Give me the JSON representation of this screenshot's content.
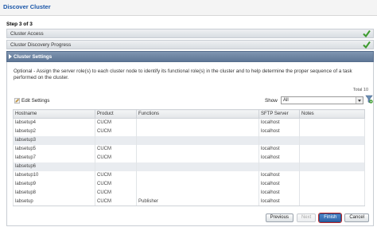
{
  "header": {
    "title": "Discover Cluster"
  },
  "step": {
    "label": "Step 3 of 3"
  },
  "accordion": [
    {
      "label": "Cluster Access",
      "done": true
    },
    {
      "label": "Cluster Discovery Progress",
      "done": true
    },
    {
      "label": "Cluster Settings",
      "active": true
    }
  ],
  "description": "Optional - Assign the server role(s) to each cluster node to identify its functional role(s) in the cluster and to help determine the proper sequence of a task performed on the cluster.",
  "total": "Total 10",
  "toolbar": {
    "edit_label": "Edit Settings",
    "show_label": "Show",
    "show_value": "All"
  },
  "columns": [
    "Hostname",
    "Product",
    "Functions",
    "SFTP Server",
    "Notes"
  ],
  "rows": [
    [
      "labsetup4",
      "CUCM",
      "",
      "localhost",
      ""
    ],
    [
      "labsetup2",
      "CUCM",
      "",
      "localhost",
      ""
    ],
    [
      "labsetup3",
      "",
      "",
      "",
      ""
    ],
    [
      "labsetup5",
      "CUCM",
      "",
      "localhost",
      ""
    ],
    [
      "labsetup7",
      "CUCM",
      "",
      "localhost",
      ""
    ],
    [
      "labsetup6",
      "",
      "",
      "",
      ""
    ],
    [
      "labsetup10",
      "CUCM",
      "",
      "localhost",
      ""
    ],
    [
      "labsetup9",
      "CUCM",
      "",
      "localhost",
      ""
    ],
    [
      "labsetup8",
      "CUCM",
      "",
      "localhost",
      ""
    ],
    [
      "labsetup",
      "CUCM",
      "Publisher",
      "localhost",
      ""
    ]
  ],
  "buttons": {
    "previous": "Previous",
    "next": "Next",
    "finish": "Finish",
    "cancel": "Cancel"
  },
  "colors": {
    "accent": "#1a56a8",
    "active_header": "#6a819f",
    "check": "#3c9b2e"
  }
}
